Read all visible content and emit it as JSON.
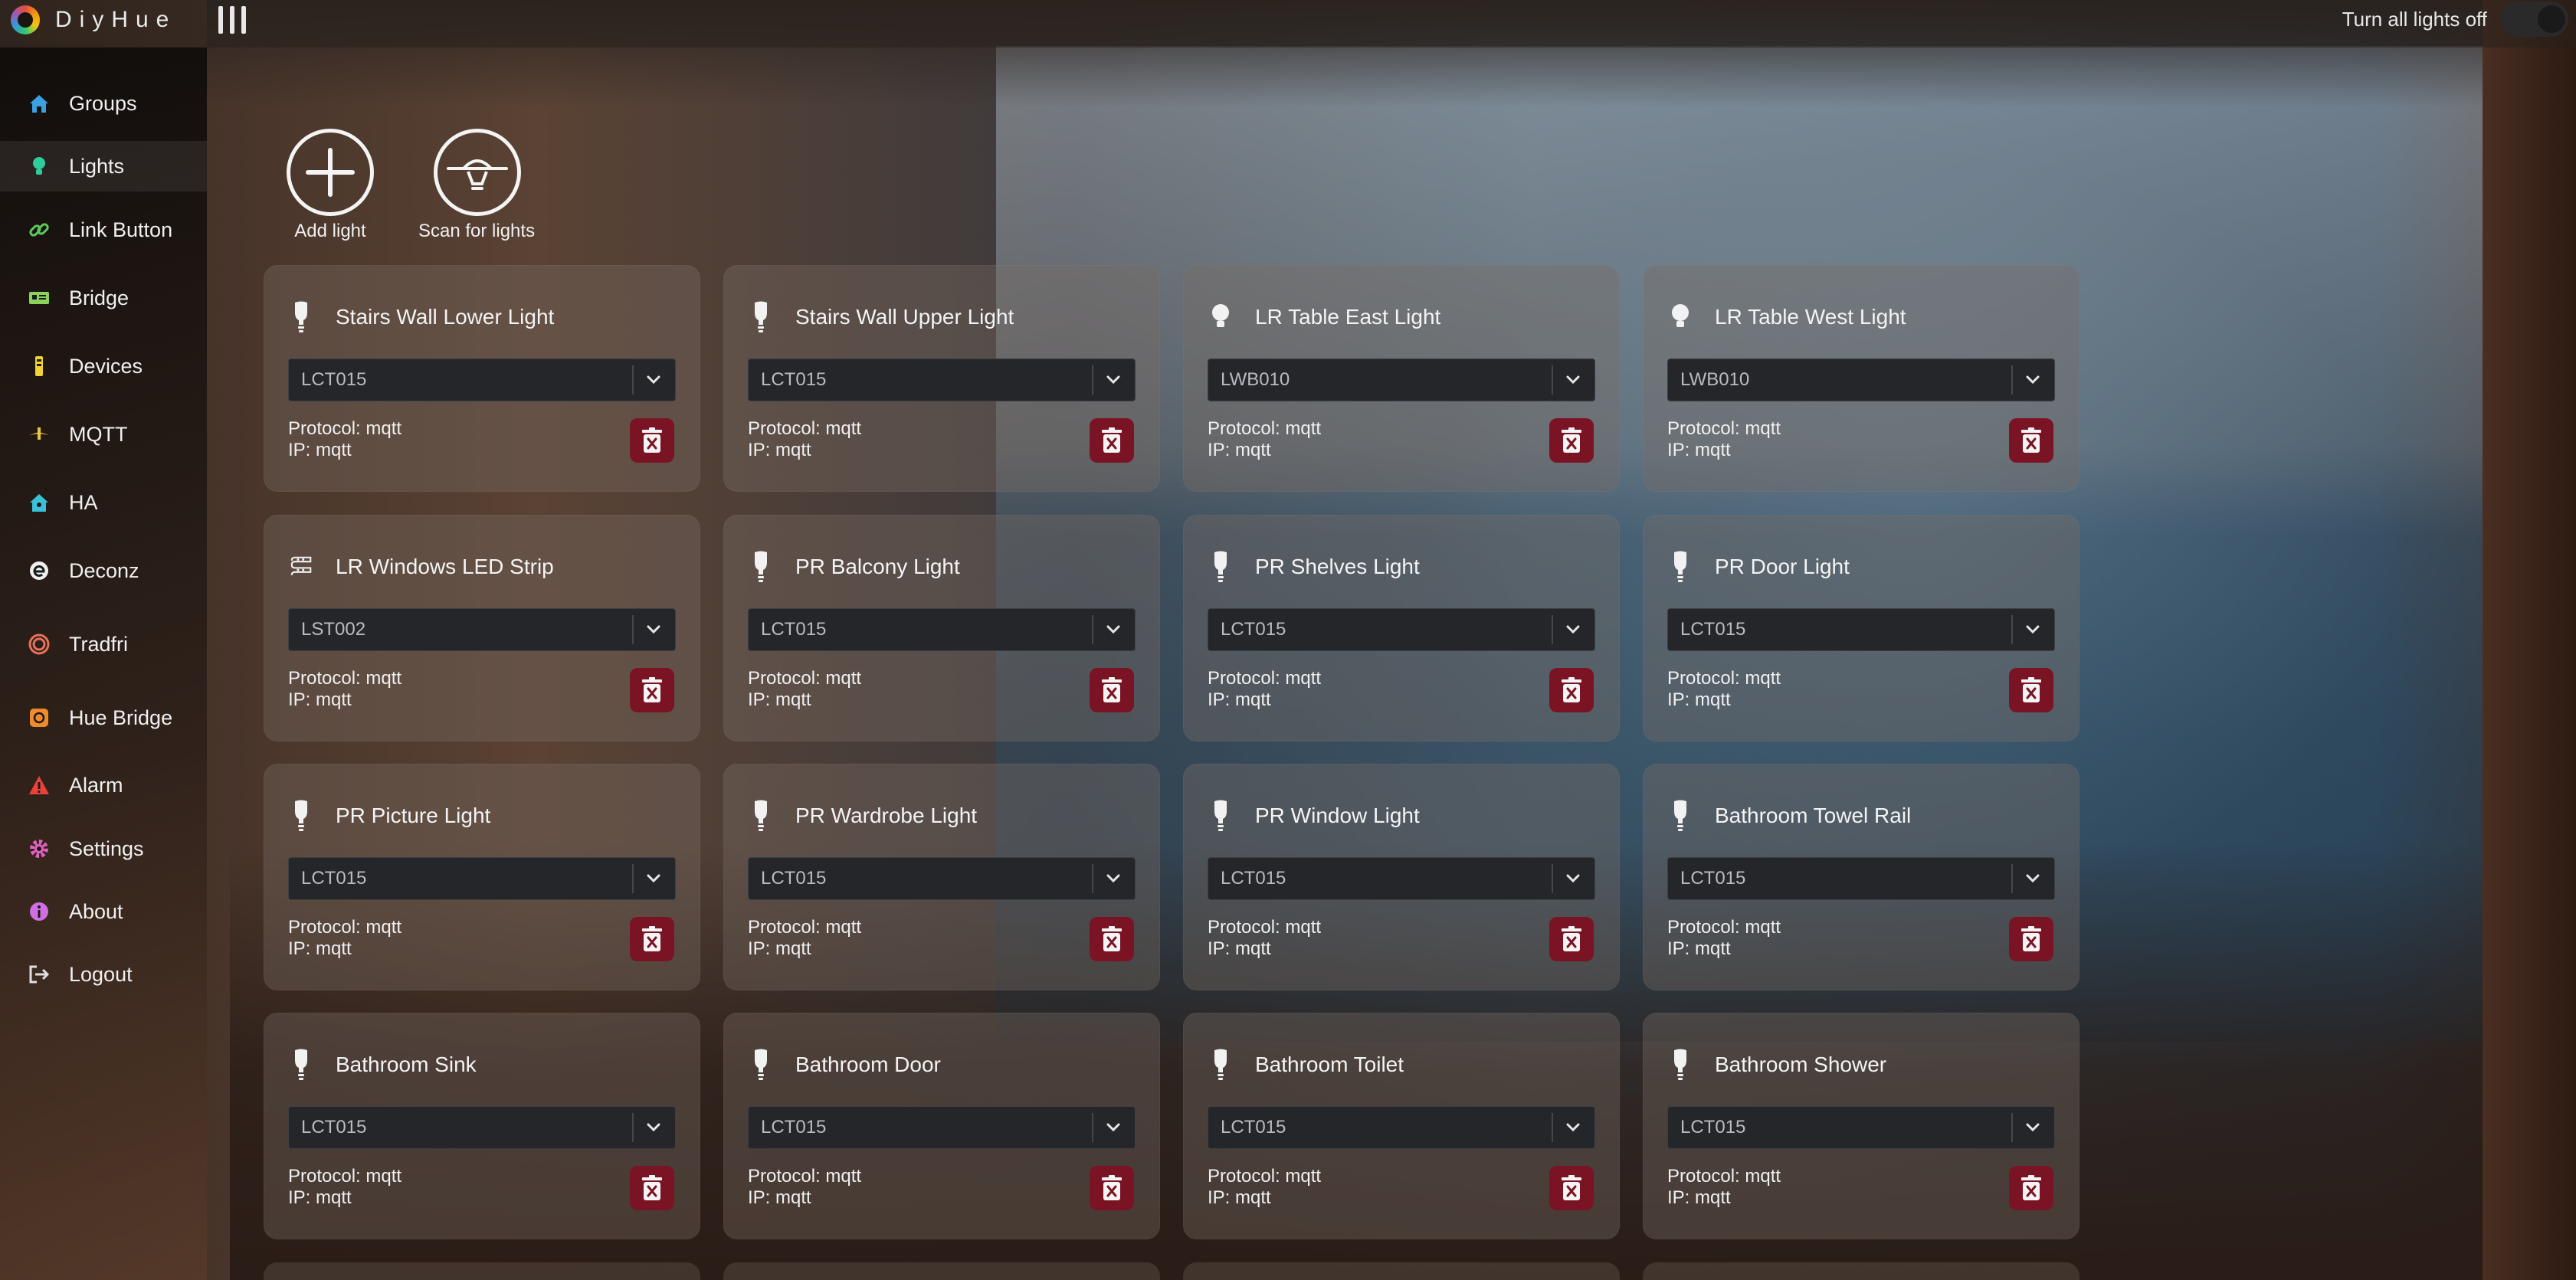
{
  "app": {
    "brand": "DiyHue",
    "turn_all_off": "Turn all lights off"
  },
  "sidebar": {
    "items": [
      {
        "label": "Groups",
        "icon": "home-icon",
        "color": "#3aa0e0"
      },
      {
        "label": "Lights",
        "icon": "bulb-icon",
        "color": "#2ecc9a",
        "active": true
      },
      {
        "label": "Link Button",
        "icon": "link-icon",
        "color": "#5cc85c"
      },
      {
        "label": "Bridge",
        "icon": "bridge-icon",
        "color": "#8bd15a"
      },
      {
        "label": "Devices",
        "icon": "device-icon",
        "color": "#f1d232"
      },
      {
        "label": "MQTT",
        "icon": "mqtt-icon",
        "color": "#e8c640"
      },
      {
        "label": "HA",
        "icon": "ha-icon",
        "color": "#3ac0d8"
      },
      {
        "label": "Deconz",
        "icon": "deconz-icon",
        "color": "#f0f0f0"
      },
      {
        "label": "Tradfri",
        "icon": "tradfri-icon",
        "color": "#e8705a"
      },
      {
        "label": "Hue Bridge",
        "icon": "hue-bridge-icon",
        "color": "#f08a2a"
      },
      {
        "label": "Alarm",
        "icon": "alarm-icon",
        "color": "#e8423a"
      },
      {
        "label": "Settings",
        "icon": "gear-icon",
        "color": "#e060c0"
      },
      {
        "label": "About",
        "icon": "info-icon",
        "color": "#d070e0"
      },
      {
        "label": "Logout",
        "icon": "logout-icon",
        "color": "#e0e0e0"
      }
    ]
  },
  "actions": {
    "add_light": "Add light",
    "scan_lights": "Scan for lights"
  },
  "lights": [
    {
      "name": "Stairs Wall Lower Light",
      "model": "LCT015",
      "protocol": "Protocol: mqtt",
      "ip": "IP: mqtt",
      "icon": "bulb-icon"
    },
    {
      "name": "Stairs Wall Upper Light",
      "model": "LCT015",
      "protocol": "Protocol: mqtt",
      "ip": "IP: mqtt",
      "icon": "bulb-icon"
    },
    {
      "name": "LR Table East Light",
      "model": "LWB010",
      "protocol": "Protocol: mqtt",
      "ip": "IP: mqtt",
      "icon": "round-bulb-icon"
    },
    {
      "name": "LR Table West Light",
      "model": "LWB010",
      "protocol": "Protocol: mqtt",
      "ip": "IP: mqtt",
      "icon": "round-bulb-icon"
    },
    {
      "name": "LR Windows LED Strip",
      "model": "LST002",
      "protocol": "Protocol: mqtt",
      "ip": "IP: mqtt",
      "icon": "led-strip-icon"
    },
    {
      "name": "PR Balcony Light",
      "model": "LCT015",
      "protocol": "Protocol: mqtt",
      "ip": "IP: mqtt",
      "icon": "bulb-icon"
    },
    {
      "name": "PR Shelves Light",
      "model": "LCT015",
      "protocol": "Protocol: mqtt",
      "ip": "IP: mqtt",
      "icon": "bulb-icon"
    },
    {
      "name": "PR Door Light",
      "model": "LCT015",
      "protocol": "Protocol: mqtt",
      "ip": "IP: mqtt",
      "icon": "bulb-icon"
    },
    {
      "name": "PR Picture Light",
      "model": "LCT015",
      "protocol": "Protocol: mqtt",
      "ip": "IP: mqtt",
      "icon": "bulb-icon"
    },
    {
      "name": "PR Wardrobe Light",
      "model": "LCT015",
      "protocol": "Protocol: mqtt",
      "ip": "IP: mqtt",
      "icon": "bulb-icon"
    },
    {
      "name": "PR Window Light",
      "model": "LCT015",
      "protocol": "Protocol: mqtt",
      "ip": "IP: mqtt",
      "icon": "bulb-icon"
    },
    {
      "name": "Bathroom Towel Rail",
      "model": "LCT015",
      "protocol": "Protocol: mqtt",
      "ip": "IP: mqtt",
      "icon": "bulb-icon"
    },
    {
      "name": "Bathroom Sink",
      "model": "LCT015",
      "protocol": "Protocol: mqtt",
      "ip": "IP: mqtt",
      "icon": "bulb-icon"
    },
    {
      "name": "Bathroom Door",
      "model": "LCT015",
      "protocol": "Protocol: mqtt",
      "ip": "IP: mqtt",
      "icon": "bulb-icon"
    },
    {
      "name": "Bathroom Toilet",
      "model": "LCT015",
      "protocol": "Protocol: mqtt",
      "ip": "IP: mqtt",
      "icon": "bulb-icon"
    },
    {
      "name": "Bathroom Shower",
      "model": "LCT015",
      "protocol": "Protocol: mqtt",
      "ip": "IP: mqtt",
      "icon": "bulb-icon"
    }
  ],
  "colors": {
    "delete_button": "#7a1324",
    "select_bg": "#24262a"
  }
}
